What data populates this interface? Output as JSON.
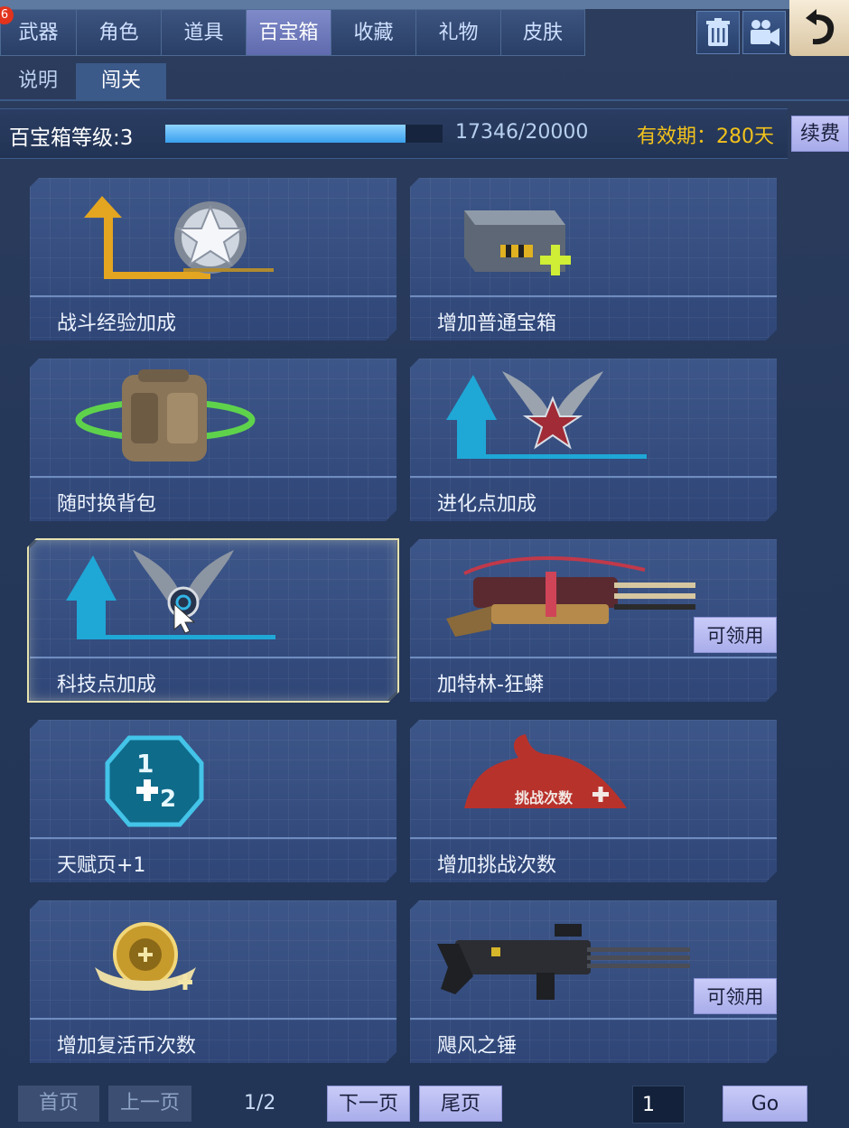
{
  "top_tabs": [
    {
      "label": "武器"
    },
    {
      "label": "角色"
    },
    {
      "label": "道具"
    },
    {
      "label": "百宝箱",
      "active": true
    },
    {
      "label": "收藏"
    },
    {
      "label": "礼物"
    },
    {
      "label": "皮肤"
    }
  ],
  "notification_badge": "6",
  "sub_tabs": [
    {
      "label": "说明"
    },
    {
      "label": "闯关",
      "active": true
    }
  ],
  "level": {
    "label": "百宝箱等级:3",
    "progress_current": 17346,
    "progress_max": 20000,
    "progress_text": "17346/20000",
    "validity": "有效期：280天",
    "renew_label": "续费"
  },
  "items": [
    {
      "name": "战斗经验加成",
      "icon": "exp-boost-icon"
    },
    {
      "name": "增加普通宝箱",
      "icon": "chest-plus-icon"
    },
    {
      "name": "随时换背包",
      "icon": "backpack-swap-icon"
    },
    {
      "name": "进化点加成",
      "icon": "evolution-point-icon"
    },
    {
      "name": "科技点加成",
      "icon": "tech-point-icon",
      "selected": true
    },
    {
      "name": "加特林-狂蟒",
      "icon": "gatling-python-icon",
      "claim": "可领用"
    },
    {
      "name": "天赋页+1",
      "icon": "talent-page-icon"
    },
    {
      "name": "增加挑战次数",
      "icon": "challenge-count-icon"
    },
    {
      "name": "增加复活币次数",
      "icon": "revive-coin-icon"
    },
    {
      "name": "飓风之锤",
      "icon": "hurricane-hammer-icon",
      "claim": "可领用"
    }
  ],
  "pagination": {
    "first": "首页",
    "prev": "上一页",
    "page_info": "1/2",
    "next": "下一页",
    "last": "尾页",
    "page_input_value": "1",
    "go": "Go"
  },
  "colors": {
    "background": "#26385a",
    "card": "#3a5283",
    "accent_gold": "#f2c21c",
    "button_lilac": "#b8bbf2",
    "progress_blue": "#3aa0ee"
  }
}
